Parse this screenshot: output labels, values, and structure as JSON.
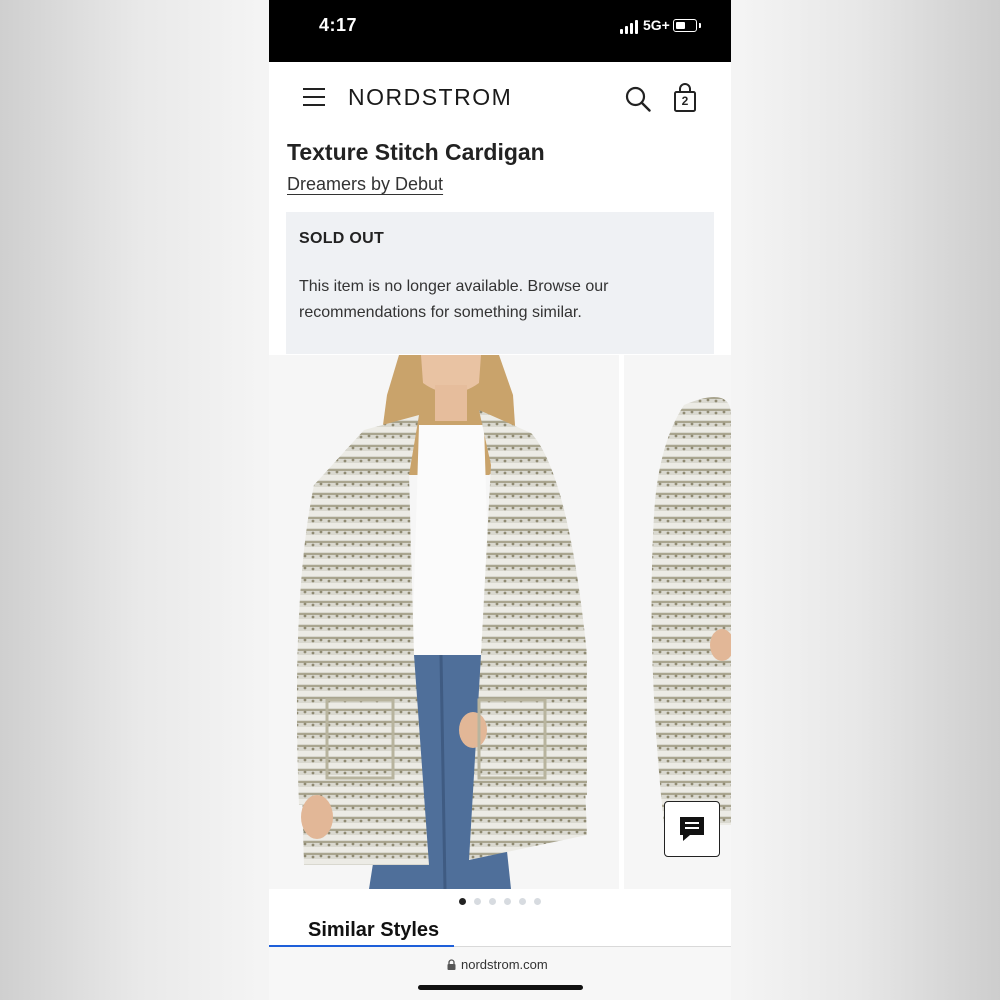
{
  "status_bar": {
    "time": "4:17",
    "network": "5G+"
  },
  "header": {
    "brand": "NORDSTROM",
    "bag_count": "2",
    "menu_icon": "hamburger-menu-icon",
    "search_icon": "search-icon",
    "bag_icon": "shopping-bag-icon"
  },
  "product": {
    "title": "Texture Stitch Cardigan",
    "brand": "Dreamers by Debut"
  },
  "notice": {
    "heading": "SOLD OUT",
    "body": "This item is no longer available. Browse our recommendations for something similar."
  },
  "gallery": {
    "image_count": 6,
    "active_index": 0
  },
  "chat": {
    "icon": "chat-icon"
  },
  "tabs": {
    "similar_label": "Similar Styles"
  },
  "browser": {
    "url": "nordstrom.com"
  },
  "colors": {
    "accent": "#1e5fd9",
    "notice_bg": "#eff1f4",
    "dot_active": "#222222",
    "dot_inactive": "#d7dbe0"
  }
}
